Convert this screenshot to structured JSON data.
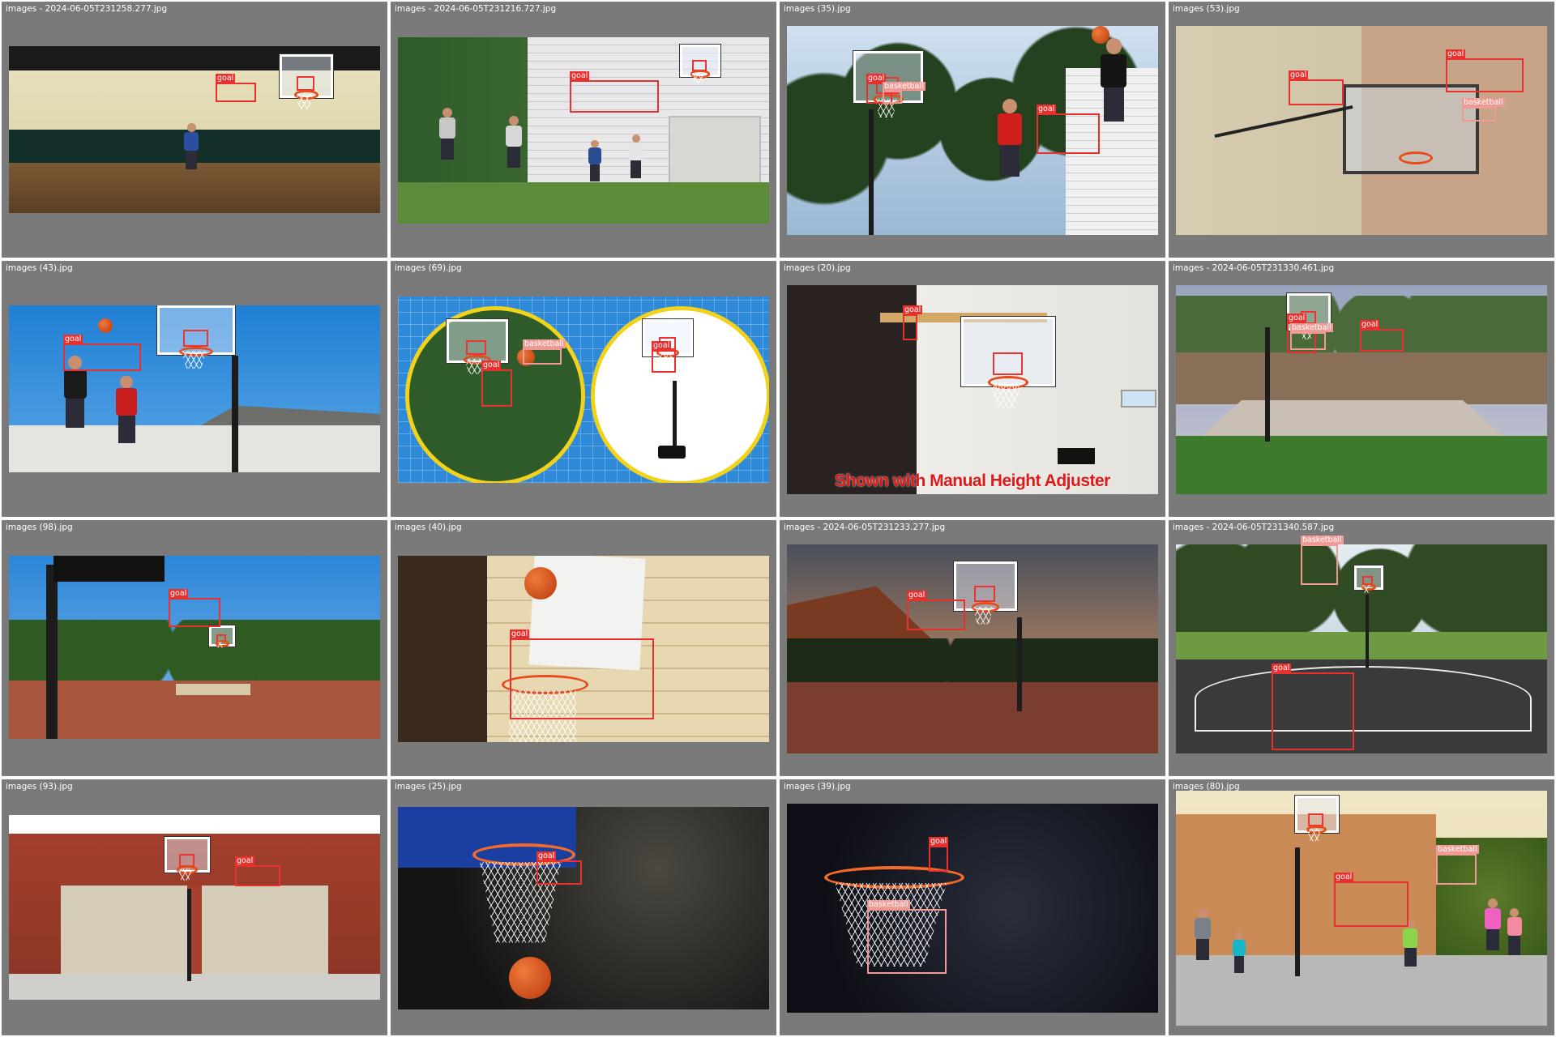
{
  "colors": {
    "tile_bg": "#7a7a7a",
    "goal_box": "#e8302e",
    "basketball_box": "#f09a96"
  },
  "tiles": [
    {
      "label": "images - 2024-06-05T231258.277.jpg",
      "scene": "indoor-gym",
      "boxes": [
        {
          "tag": "goal"
        }
      ]
    },
    {
      "label": "images - 2024-06-05T231216.727.jpg",
      "scene": "house-driveway",
      "boxes": [
        {
          "tag": "goal"
        }
      ]
    },
    {
      "label": "images (35).jpg",
      "scene": "trees-dunk",
      "boxes": [
        {
          "tag": "goal"
        },
        {
          "tag": "basketball"
        },
        {
          "tag": "goal"
        }
      ]
    },
    {
      "label": "images (53).jpg",
      "scene": "wall-mount",
      "boxes": [
        {
          "tag": "goal"
        },
        {
          "tag": "goal"
        },
        {
          "tag": "basketball"
        }
      ]
    },
    {
      "label": "images (43).jpg",
      "scene": "sky-dunk",
      "boxes": [
        {
          "tag": "goal"
        }
      ]
    },
    {
      "label": "images (69).jpg",
      "scene": "product-circles",
      "boxes": [
        {
          "tag": "basketball"
        },
        {
          "tag": "goal"
        },
        {
          "tag": "goal"
        }
      ]
    },
    {
      "label": "images (20).jpg",
      "scene": "garage-mount",
      "caption": "Shown with Manual Height Adjuster",
      "boxes": [
        {
          "tag": "goal"
        }
      ]
    },
    {
      "label": "images - 2024-06-05T231330.461.jpg",
      "scene": "backyard-court",
      "boxes": [
        {
          "tag": "goal"
        },
        {
          "tag": "basketball"
        },
        {
          "tag": "goal"
        }
      ]
    },
    {
      "label": "images (98).jpg",
      "scene": "park-court",
      "boxes": [
        {
          "tag": "goal"
        }
      ]
    },
    {
      "label": "images (40).jpg",
      "scene": "wood-wall",
      "boxes": [
        {
          "tag": "goal"
        }
      ]
    },
    {
      "label": "images - 2024-06-05T231233.277.jpg",
      "scene": "canyon-court",
      "boxes": [
        {
          "tag": "goal"
        }
      ]
    },
    {
      "label": "images - 2024-06-05T231340.587.jpg",
      "scene": "outdoor-court",
      "boxes": [
        {
          "tag": "basketball"
        },
        {
          "tag": "goal"
        }
      ]
    },
    {
      "label": "images (93).jpg",
      "scene": "garage-house",
      "boxes": [
        {
          "tag": "goal"
        }
      ]
    },
    {
      "label": "images (25).jpg",
      "scene": "arena-hoop",
      "boxes": [
        {
          "tag": "goal"
        }
      ]
    },
    {
      "label": "images (39).jpg",
      "scene": "dark-net",
      "boxes": [
        {
          "tag": "goal"
        },
        {
          "tag": "basketball"
        }
      ]
    },
    {
      "label": "images (80).jpg",
      "scene": "family-driveway",
      "boxes": [
        {
          "tag": "basketball"
        },
        {
          "tag": "goal"
        }
      ]
    }
  ]
}
